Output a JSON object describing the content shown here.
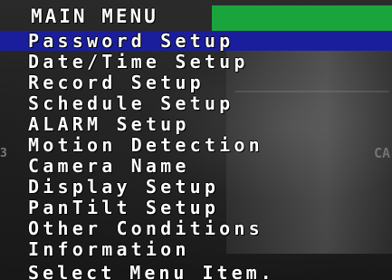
{
  "menu": {
    "title": "MAIN MENU",
    "items": [
      {
        "label": "Password Setup",
        "selected": true
      },
      {
        "label": "Date/Time Setup",
        "selected": false
      },
      {
        "label": "Record Setup",
        "selected": false
      },
      {
        "label": "Schedule Setup",
        "selected": false
      },
      {
        "label": "ALARM Setup",
        "selected": false
      },
      {
        "label": "Motion Detection",
        "selected": false
      },
      {
        "label": "Camera Name",
        "selected": false
      },
      {
        "label": "Display Setup",
        "selected": false
      },
      {
        "label": "PanTilt Setup",
        "selected": false
      },
      {
        "label": "Other Conditions",
        "selected": false
      },
      {
        "label": "Information",
        "selected": false
      }
    ],
    "status": "Select Menu Item."
  },
  "overlay": {
    "left_marker": "3",
    "right_marker": "CA"
  },
  "colors": {
    "highlight": "#1a1e9c",
    "title_bar_accent": "#1aa53c",
    "text": "#ffffff"
  }
}
